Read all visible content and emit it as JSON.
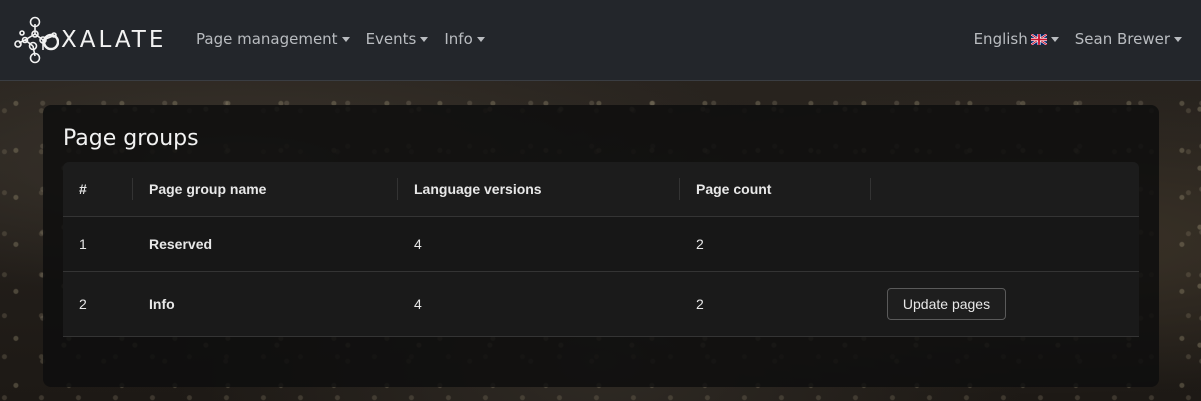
{
  "brand": {
    "name": "XALATE",
    "logo_icon": "molecule-logo-icon"
  },
  "nav": {
    "left": [
      {
        "label": "Page management"
      },
      {
        "label": "Events"
      },
      {
        "label": "Info"
      }
    ],
    "language": {
      "label": "English",
      "flag_icon": "uk-flag-icon"
    },
    "user": {
      "label": "Sean Brewer"
    }
  },
  "card": {
    "title": "Page groups",
    "table": {
      "headers": [
        "#",
        "Page group name",
        "Language versions",
        "Page count",
        ""
      ],
      "rows": [
        {
          "num": "1",
          "name": "Reserved",
          "languages": "4",
          "pages": "2",
          "action": ""
        },
        {
          "num": "2",
          "name": "Info",
          "languages": "4",
          "pages": "2",
          "action": "Update pages"
        }
      ]
    }
  },
  "colors": {
    "navbar": "#23262b",
    "card": "#0e0e0e",
    "text": "#e6e6e6"
  }
}
